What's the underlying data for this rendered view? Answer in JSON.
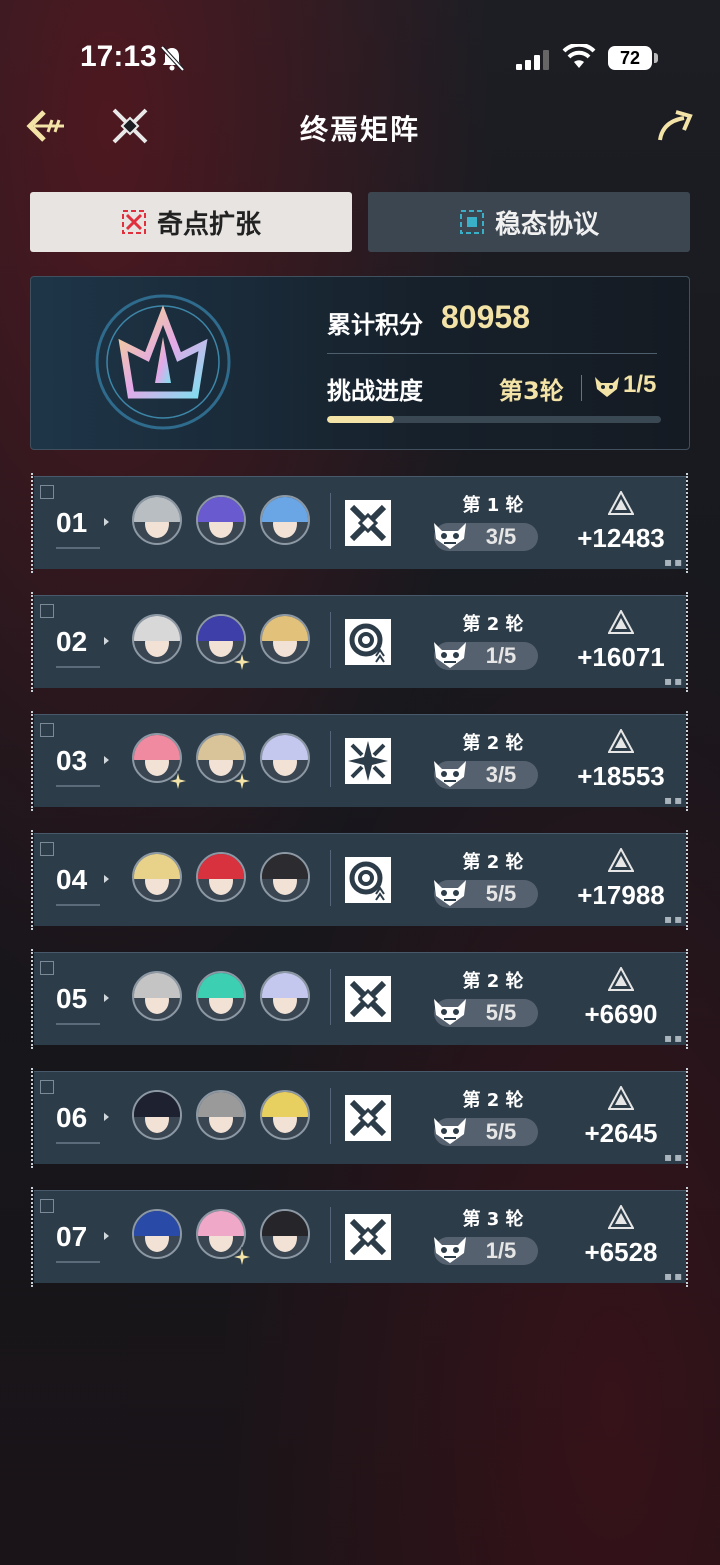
{
  "status_bar": {
    "time": "17:13",
    "battery": "72"
  },
  "header": {
    "title": "终焉矩阵"
  },
  "tabs": [
    {
      "label": "奇点扩张",
      "active": true
    },
    {
      "label": "稳态协议",
      "active": false
    }
  ],
  "summary": {
    "score_label": "累计积分",
    "score_value": "80958",
    "progress_label": "挑战进度",
    "round": "第3轮",
    "stage": "1/5",
    "progress_fraction": 0.2
  },
  "rows": [
    {
      "num": "01",
      "round": "第 1 轮",
      "stage": "3/5",
      "gain": "+12483",
      "mode": "crossed-swords-icon",
      "avatars": [
        [
          "#b9bec2",
          false
        ],
        [
          "#6a5ad0",
          false
        ],
        [
          "#6aa6e6",
          false
        ]
      ]
    },
    {
      "num": "02",
      "round": "第 2 轮",
      "stage": "1/5",
      "gain": "+16071",
      "mode": "spiral-icon",
      "avatars": [
        [
          "#d8d8d8",
          false
        ],
        [
          "#3e3fa8",
          true
        ],
        [
          "#e2c27a",
          false
        ]
      ]
    },
    {
      "num": "03",
      "round": "第 2 轮",
      "stage": "3/5",
      "gain": "+18553",
      "mode": "burst-icon",
      "avatars": [
        [
          "#f08aa0",
          true
        ],
        [
          "#d9c49a",
          true
        ],
        [
          "#c4c8ee",
          false
        ]
      ]
    },
    {
      "num": "04",
      "round": "第 2 轮",
      "stage": "5/5",
      "gain": "+17988",
      "mode": "spiral-icon",
      "avatars": [
        [
          "#e8d28a",
          false
        ],
        [
          "#d8323f",
          false
        ],
        [
          "#2c2c30",
          false
        ]
      ]
    },
    {
      "num": "05",
      "round": "第 2 轮",
      "stage": "5/5",
      "gain": "+6690",
      "mode": "crossed-swords-icon",
      "avatars": [
        [
          "#c4c4c4",
          false
        ],
        [
          "#3ccfb2",
          false
        ],
        [
          "#c4c8ee",
          false
        ]
      ]
    },
    {
      "num": "06",
      "round": "第 2 轮",
      "stage": "5/5",
      "gain": "+2645",
      "mode": "crossed-swords-icon",
      "avatars": [
        [
          "#1e2230",
          false
        ],
        [
          "#9a9a9a",
          false
        ],
        [
          "#e8d060",
          false
        ]
      ]
    },
    {
      "num": "07",
      "round": "第 3 轮",
      "stage": "1/5",
      "gain": "+6528",
      "mode": "crossed-swords-icon",
      "avatars": [
        [
          "#2a4aa8",
          false
        ],
        [
          "#f0a8c8",
          true
        ],
        [
          "#26262a",
          false
        ]
      ]
    }
  ]
}
